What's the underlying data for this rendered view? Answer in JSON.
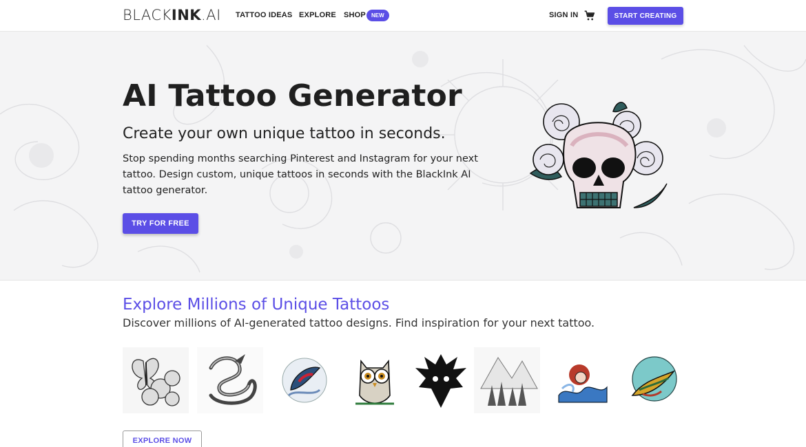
{
  "nav": {
    "logo_light": "BLACK",
    "logo_bold": "INK",
    "logo_suffix": ".AI",
    "links": {
      "tattoo_ideas": "TATTOO IDEAS",
      "explore": "EXPLORE",
      "shop": "SHOP",
      "shop_badge": "NEW"
    },
    "sign_in": "SIGN IN",
    "cart_icon": "shopping-cart-icon",
    "start_creating": "START CREATING"
  },
  "hero": {
    "title": "AI Tattoo Generator",
    "subtitle": "Create your own unique tattoo in seconds.",
    "description": "Stop spending months searching Pinterest and Instagram for your next tattoo. Design custom, unique tattoos in seconds with the BlackInk AI tattoo generator.",
    "cta": "TRY FOR FREE"
  },
  "explore": {
    "title": "Explore Millions of Unique Tattoos",
    "subtitle": "Discover millions of AI-generated tattoo designs. Find inspiration for your next tattoo.",
    "cta": "EXPLORE NOW",
    "thumbnails": [
      "butterfly-roses",
      "dragon",
      "koi-fish",
      "owl",
      "eagle-head",
      "forest-mountains",
      "mermaid-waves",
      "hummingbird"
    ]
  },
  "colors": {
    "accent": "#5b4ee6",
    "hero_bg": "#f4f4f5",
    "text": "#222222"
  }
}
